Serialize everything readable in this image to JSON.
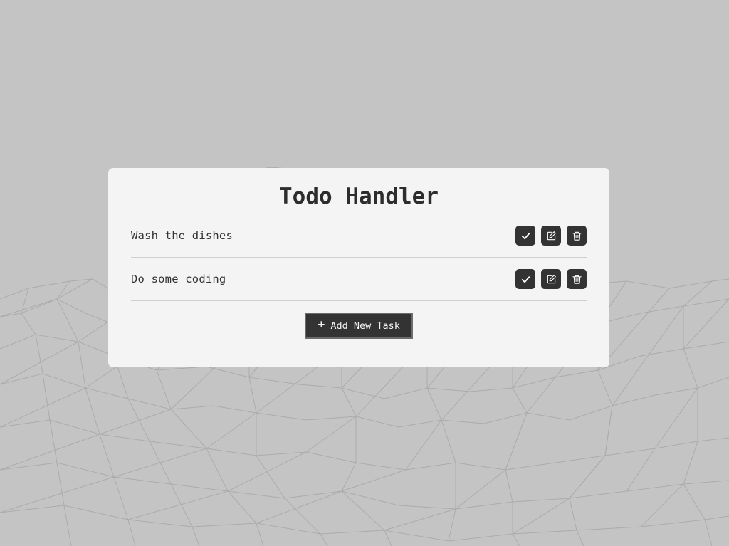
{
  "app": {
    "title": "Todo Handler"
  },
  "tasks": [
    {
      "text": "Wash the dishes"
    },
    {
      "text": "Do some coding"
    }
  ],
  "actions": {
    "complete_icon": "check-icon",
    "edit_icon": "edit-icon",
    "delete_icon": "trash-icon"
  },
  "add_button": {
    "icon": "+",
    "label": "Add New Task"
  },
  "colors": {
    "background": "#c4c4c4",
    "card": "#f4f4f4",
    "button": "#333333",
    "text": "#2d2d2d"
  }
}
